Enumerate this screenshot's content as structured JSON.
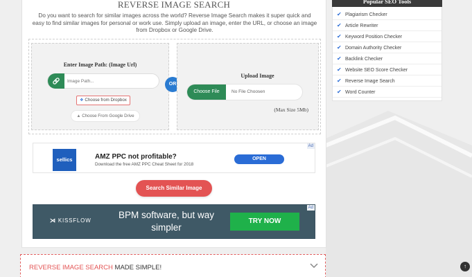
{
  "colors": {
    "accent_green": "#2e8b57",
    "accent_blue": "#2a7bd1",
    "accent_red": "#e35353",
    "sidebar_head": "#3a3a3a"
  },
  "main": {
    "title": "REVERSE IMAGE SEARCH",
    "intro": "Do you want to search for similar images across the world? Reverse Image Search makes it super quick and easy to find similar images for personal or work use. Simply upload an image, enter the URL, or choose an image from Dropbox or Google Drive.",
    "left_panel": {
      "heading": "Enter Image Path: (Image Url)",
      "input_placeholder": "Image Path...",
      "link_icon": "link-icon",
      "dropbox_label": "Choose from Dropbox",
      "drive_label": "Choose From Google Drive"
    },
    "or_label": "OR",
    "right_panel": {
      "heading": "Upload Image",
      "choose_file": "Choose File",
      "file_status": "No File Choosen",
      "max_size": "(Max Size 5Mb)"
    },
    "ad1": {
      "badge": "Ad",
      "logo": "sellics",
      "headline": "AMZ PPC not profitable?",
      "subline": "Download the free AMZ PPC Cheat Sheet for 2018",
      "cta": "OPEN"
    },
    "search_button": "Search Similar Image",
    "ad2": {
      "badge": "Ad",
      "logo": "KISSFLOW",
      "text": "BPM software, but way simpler",
      "cta": "TRY NOW"
    }
  },
  "accordion": {
    "title_highlight": "REVERSE IMAGE SEARCH",
    "title_rest": " MADE SIMPLE!"
  },
  "sidebar": {
    "title": "Popular SEO Tools",
    "items": [
      "Plagiarism Checker",
      "Article Rewriter",
      "Keyword Position Checker",
      "Domain Authority Checker",
      "Backlink Checker",
      "Website SEO Score Checker",
      "Reverse Image Search",
      "Word Counter"
    ]
  },
  "scroll_top_label": "↑"
}
